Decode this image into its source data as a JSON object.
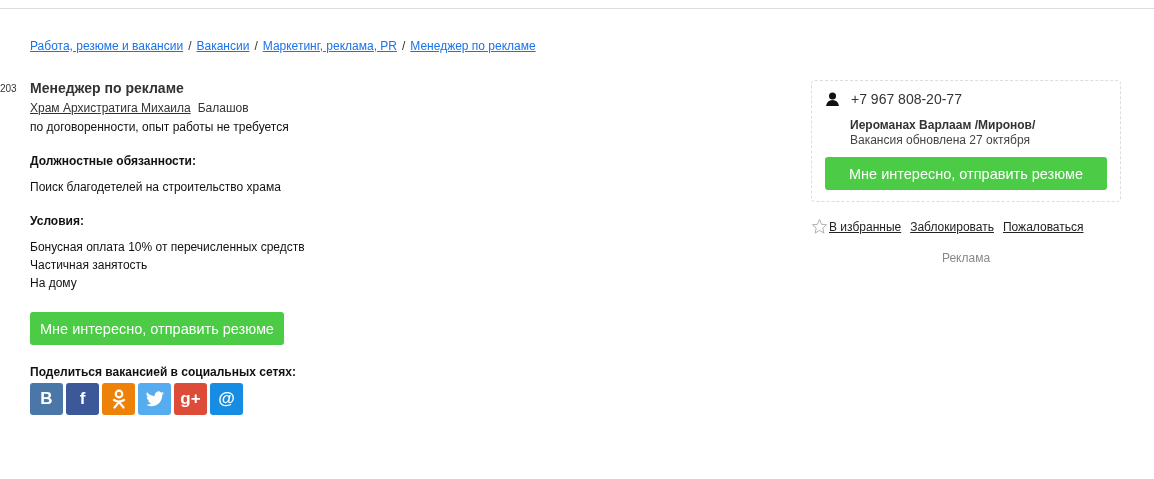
{
  "breadcrumbs": [
    "Работа, резюме и вакансии",
    "Вакансии",
    "Маркетинг, реклама, PR",
    "Менеджер по рекламе"
  ],
  "breadcrumb_separators": [
    "/",
    "/",
    "/"
  ],
  "side_number": "203",
  "vacancy": {
    "title": "Менеджер по рекламе",
    "employer": "Храм Архистратига Михаила",
    "city": "Балашов",
    "summary": "по договоренности, опыт работы не требуется"
  },
  "sections": [
    {
      "heading": "Должностные обязанности:",
      "lines": [
        "Поиск благодетелей на строительство храма"
      ]
    },
    {
      "heading": "Условия:",
      "lines": [
        "Бонусная оплата 10% от перечисленных средств",
        "Частичная занятость",
        "На дому"
      ]
    }
  ],
  "apply_button": "Мне интересно, отправить резюме",
  "share": {
    "heading": "Поделиться вакансией в социальных сетях:",
    "networks": [
      {
        "kind": "vk",
        "label": "В",
        "color": "#4a76a8"
      },
      {
        "kind": "facebook",
        "label": "f",
        "color": "#3b5998"
      },
      {
        "kind": "ok",
        "color": "#ee8208"
      },
      {
        "kind": "twitter",
        "color": "#55acee"
      },
      {
        "kind": "gplus",
        "label": "g+",
        "color": "#dd4b39"
      },
      {
        "kind": "mail",
        "label": "@",
        "color": "#168de2"
      }
    ]
  },
  "contact": {
    "phone": "+7 967 808-20-77",
    "name": "Иероманах Варлаам /Миронов/",
    "updated": "Вакансия обновлена 27 октября",
    "button": "Мне интересно, отправить резюме"
  },
  "actions": [
    "В избранные",
    "Заблокировать",
    "Пожаловаться"
  ],
  "ad_label": "Реклама"
}
